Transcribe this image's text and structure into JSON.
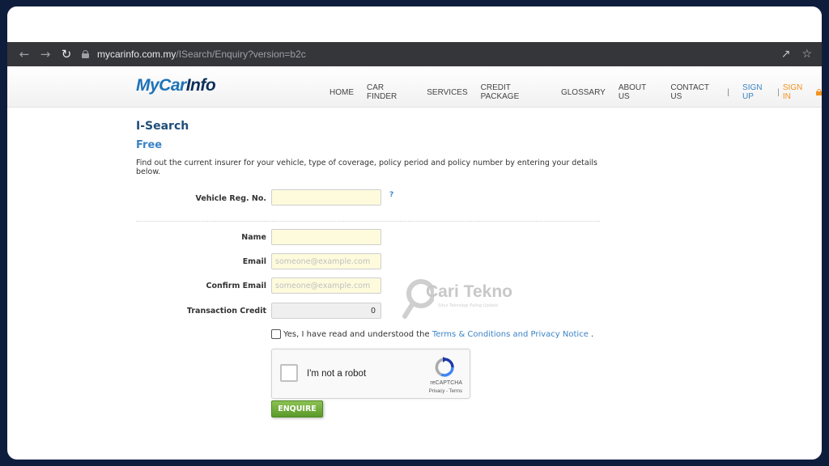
{
  "browser": {
    "url_domain": "mycarinfo.com.my",
    "url_path": "/ISearch/Enquiry?version=b2c"
  },
  "site": {
    "logo_part1": "MyCar",
    "logo_part2": "Info",
    "nav": {
      "home": "HOME",
      "car_finder": "CAR FINDER",
      "services": "SERVICES",
      "credit_package": "CREDIT PACKAGE",
      "glossary": "GLOSSARY",
      "about_us": "ABOUT US",
      "contact_us": "CONTACT US",
      "separator": "|",
      "sign_up": "SIGN UP",
      "sign_in": "SIGN IN"
    }
  },
  "page": {
    "title": "I-Search",
    "subtitle": "Free",
    "description": "Find out the current insurer for your vehicle, type of coverage, policy period and policy number by entering your details below."
  },
  "form": {
    "vehicle_label": "Vehicle Reg. No.",
    "vehicle_value": "",
    "help_mark": "?",
    "name_label": "Name",
    "name_value": "",
    "email_label": "Email",
    "email_placeholder": "someone@example.com",
    "confirm_email_label": "Confirm Email",
    "confirm_email_placeholder": "someone@example.com",
    "credit_label": "Transaction Credit",
    "credit_value": "0",
    "agree_prefix": "Yes, I have read and understood the ",
    "agree_link": "Terms & Conditions and Privacy Notice",
    "agree_suffix": " .",
    "captcha_text": "I'm not a robot",
    "captcha_brand": "reCAPTCHA",
    "captcha_terms": "Privacy - Terms",
    "submit_label": "ENQUIRE"
  },
  "watermark": {
    "text": "Cari Tekno",
    "subtext": "Situs Teknologi Paling Update"
  },
  "colors": {
    "frame_bg": "#0f1d3d",
    "brand_blue": "#1c72b8",
    "heading_navy": "#1f4e79",
    "link_blue": "#3b83c6",
    "sign_in_orange": "#f3921f",
    "field_yellow": "#fdfbdc",
    "button_green": "#6aa833"
  },
  "icons": [
    "back-arrow-icon",
    "forward-arrow-icon",
    "reload-icon",
    "lock-icon",
    "share-icon",
    "star-icon",
    "padlock-icon",
    "recaptcha-logo-icon",
    "magnifier-icon"
  ]
}
